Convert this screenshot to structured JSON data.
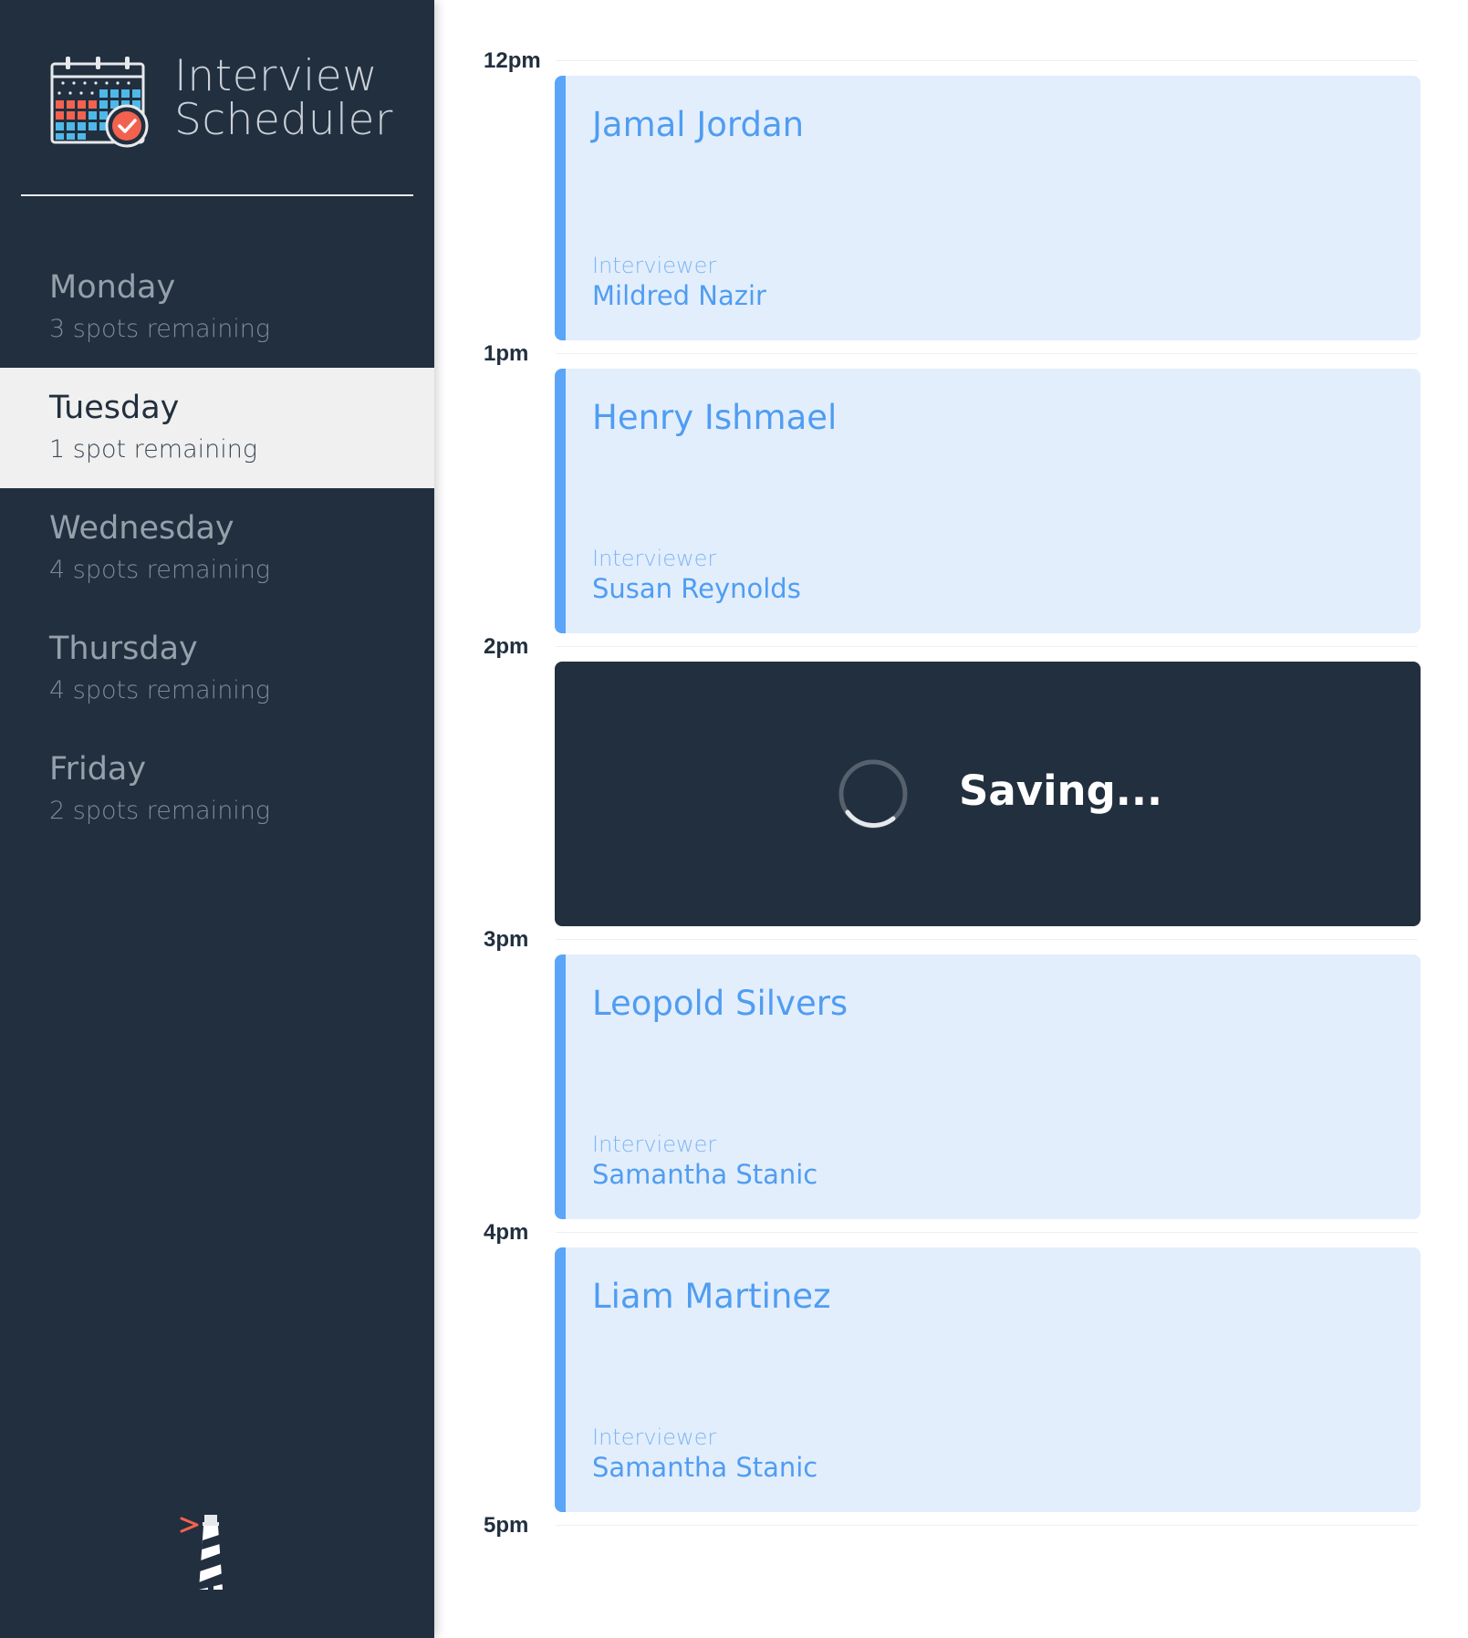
{
  "app": {
    "title_line1": "Interview",
    "title_line2": "Scheduler"
  },
  "icons": {
    "logo": "calendar-check-icon",
    "footer": "lighthouse-icon"
  },
  "colors": {
    "sidebar_bg": "#222f3e",
    "selected_day_bg": "#f0f0f0",
    "card_bg": "#e3eefd",
    "card_accent": "#5aa5f8",
    "card_text": "#4f9df2",
    "calendar_check": "#f2624f"
  },
  "days": [
    {
      "name": "Monday",
      "spots": "3 spots remaining",
      "selected": false
    },
    {
      "name": "Tuesday",
      "spots": "1 spot remaining",
      "selected": true
    },
    {
      "name": "Wednesday",
      "spots": "4 spots remaining",
      "selected": false
    },
    {
      "name": "Thursday",
      "spots": "4 spots remaining",
      "selected": false
    },
    {
      "name": "Friday",
      "spots": "2 spots remaining",
      "selected": false
    }
  ],
  "schedule": {
    "slots": [
      {
        "time": "12pm",
        "student": "Jamal Jordan",
        "interviewer_label": "Interviewer",
        "interviewer": "Mildred Nazir"
      },
      {
        "time": "1pm",
        "student": "Henry Ishmael",
        "interviewer_label": "Interviewer",
        "interviewer": "Susan Reynolds"
      },
      {
        "time": "2pm",
        "status": "Saving..."
      },
      {
        "time": "3pm",
        "student": "Leopold Silvers",
        "interviewer_label": "Interviewer",
        "interviewer": "Samantha Stanic"
      },
      {
        "time": "4pm",
        "student": "Liam Martinez",
        "interviewer_label": "Interviewer",
        "interviewer": "Samantha Stanic"
      }
    ],
    "end_time": "5pm"
  }
}
